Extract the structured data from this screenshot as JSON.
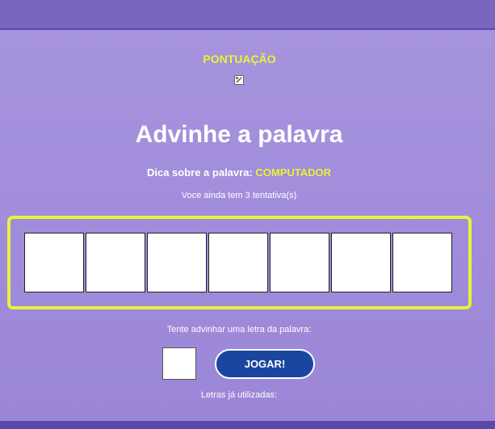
{
  "score": {
    "label": "PONTUAÇÃO",
    "icon": "broken-image-icon"
  },
  "game": {
    "title": "Advinhe a palavra",
    "hint_label": "Dica sobre a palavra:",
    "hint_value": "COMPUTADOR",
    "attempts_text": "Voce ainda tem 3 tentativa(s)",
    "word_letters": [
      "",
      "",
      "",
      "",
      "",
      "",
      ""
    ],
    "guess_prompt": "Tente advinhar uma letra da palavra:",
    "letter_input_value": "",
    "play_label": "JOGAR!",
    "used_letters_label": "Letras já utilizadas:",
    "used_letters": ""
  },
  "colors": {
    "accent_yellow": "#eaf23a",
    "background": "#a08fda",
    "header": "#7a66bf",
    "button": "#1a46a0"
  }
}
